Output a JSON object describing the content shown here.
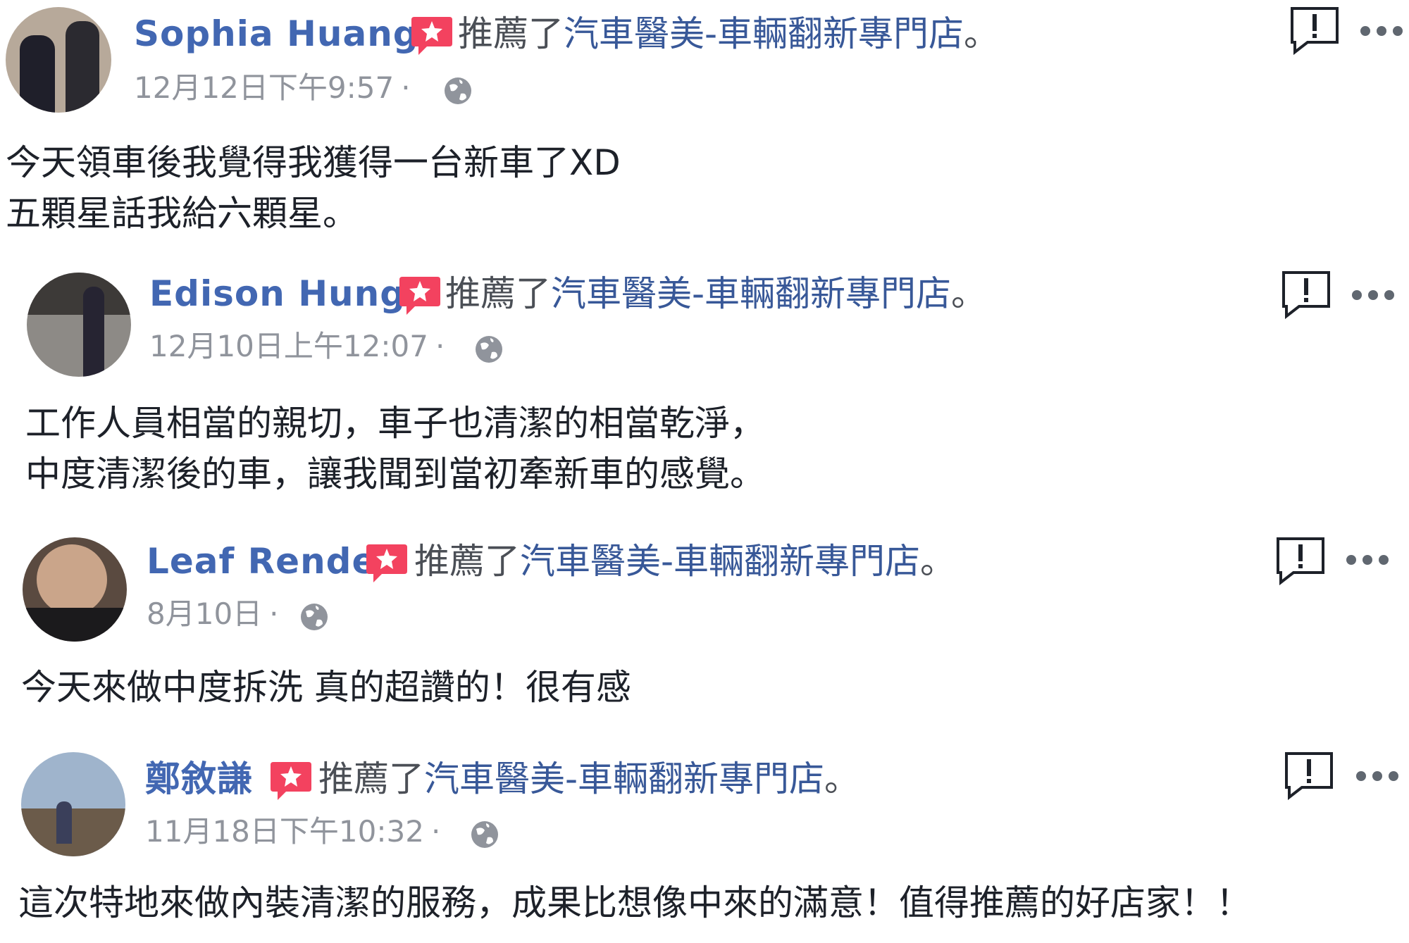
{
  "colors": {
    "name": "#4267b2",
    "page_link": "#385898",
    "secondary": "#90949c",
    "text": "#1d2129",
    "badge": "#f3425f"
  },
  "reviews": [
    {
      "author": "Sophia Huang",
      "action": "推薦了",
      "page": "汽車醫美-車輛翻新專門店",
      "period": "。",
      "time": "12月12日下午9:57",
      "separator": "·",
      "privacy_icon": "globe-icon",
      "lines": [
        "今天領車後我覺得我獲得一台新車了XD",
        "五顆星話我給六顆星。"
      ]
    },
    {
      "author": "Edison Hung",
      "action": "推薦了",
      "page": "汽車醫美-車輛翻新專門店",
      "period": "。",
      "time": "12月10日上午12:07",
      "separator": "·",
      "privacy_icon": "globe-icon",
      "lines": [
        "工作人員相當的親切，車子也清潔的相當乾淨，",
        "中度清潔後的車，讓我聞到當初牽新車的感覺。"
      ]
    },
    {
      "author": "Leaf Rende",
      "action": "推薦了",
      "page": "汽車醫美-車輛翻新專門店",
      "period": "。",
      "time": "8月10日",
      "separator": "·",
      "privacy_icon": "globe-icon",
      "lines": [
        "今天來做中度拆洗 真的超讚的！很有感"
      ]
    },
    {
      "author": "鄭敘謙",
      "action": "推薦了",
      "page": "汽車醫美-車輛翻新專門店",
      "period": "。",
      "time": "11月18日下午10:32",
      "separator": "·",
      "privacy_icon": "globe-icon",
      "lines": [
        "這次特地來做內裝清潔的服務，成果比想像中來的滿意！值得推薦的好店家！！"
      ]
    }
  ]
}
